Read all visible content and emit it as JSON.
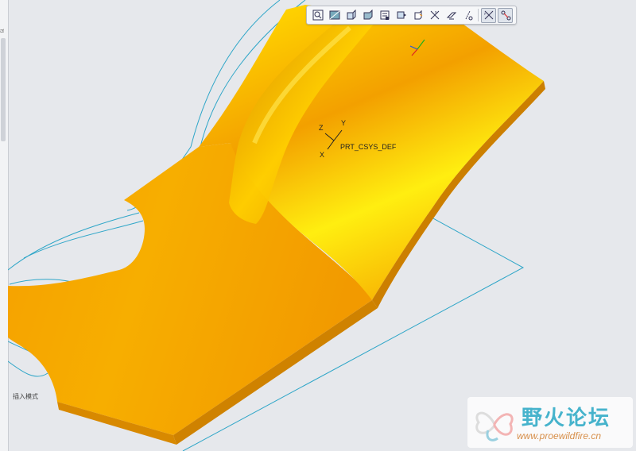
{
  "app": {
    "left_panel_text": "ಡ",
    "insert_mode_label": "插入模式"
  },
  "toolbar": {
    "items": [
      {
        "name": "refit-icon"
      },
      {
        "name": "zoom-area-icon"
      },
      {
        "name": "saved-orientations-icon"
      },
      {
        "name": "display-style-icon"
      },
      {
        "name": "view-manager-icon"
      },
      {
        "name": "datum-display-filters-icon"
      },
      {
        "name": "annotation-display-icon"
      },
      {
        "name": "spin-center-icon"
      },
      {
        "name": "csys-display-icon"
      },
      {
        "name": "axis-display-icon"
      },
      {
        "name": "plane-display-icon"
      },
      {
        "name": "point-display-icon"
      }
    ]
  },
  "model": {
    "csys_name": "PRT_CSYS_DEF",
    "axis_x": "X",
    "axis_y": "Y",
    "axis_z": "Z",
    "part_color": "#f29c00",
    "highlight_color": "#ffea00",
    "datum_line_color": "#2fa6c8"
  },
  "watermark": {
    "title": "野火论坛",
    "url": "www.proewildfire.cn"
  }
}
